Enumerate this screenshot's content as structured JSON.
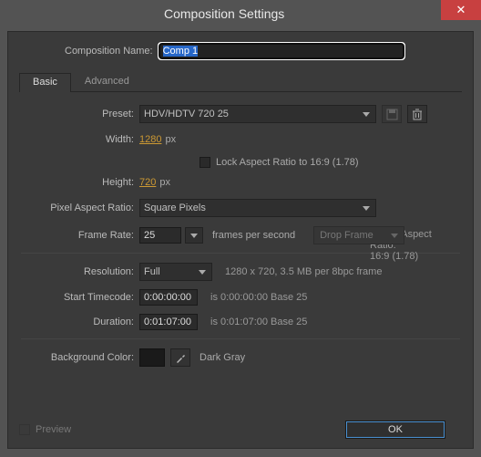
{
  "dialog": {
    "title": "Composition Settings",
    "close_icon": "✕"
  },
  "name_row": {
    "label": "Composition Name:",
    "value": "Comp 1"
  },
  "tabs": {
    "basic": "Basic",
    "advanced": "Advanced"
  },
  "preset": {
    "label": "Preset:",
    "value": "HDV/HDTV 720 25"
  },
  "width": {
    "label": "Width:",
    "value": "1280",
    "unit": "px"
  },
  "height": {
    "label": "Height:",
    "value": "720",
    "unit": "px"
  },
  "lock_aspect": {
    "label": "Lock Aspect Ratio to 16:9 (1.78)"
  },
  "par": {
    "label": "Pixel Aspect Ratio:",
    "value": "Square Pixels"
  },
  "far": {
    "label": "Frame Aspect Ratio:",
    "value": "16:9 (1.78)"
  },
  "frame_rate": {
    "label": "Frame Rate:",
    "value": "25",
    "suffix": "frames per second",
    "drop": "Drop Frame"
  },
  "resolution": {
    "label": "Resolution:",
    "value": "Full",
    "info": "1280 x 720, 3.5 MB per 8bpc frame"
  },
  "start_tc": {
    "label": "Start Timecode:",
    "value": "0:00:00:00",
    "info": "is 0:00:00:00  Base 25"
  },
  "duration": {
    "label": "Duration:",
    "value": "0:01:07:00",
    "info": "is 0:01:07:00  Base 25"
  },
  "bgcolor": {
    "label": "Background Color:",
    "value": "#1a1a1a",
    "name": "Dark Gray"
  },
  "preview": {
    "label": "Preview"
  },
  "ok": {
    "label": "OK"
  }
}
